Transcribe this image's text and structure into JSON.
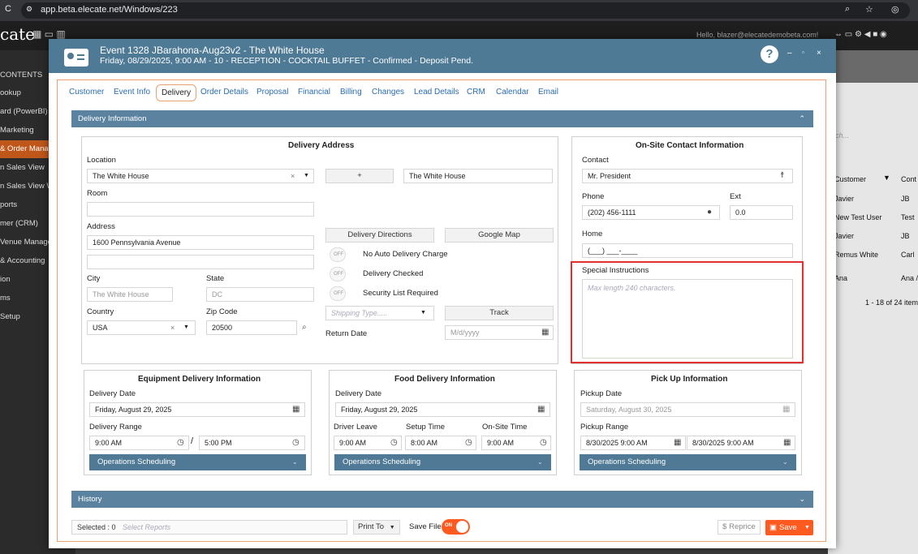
{
  "browser": {
    "url": "app.beta.elecate.net/Windows/223"
  },
  "bg_app": {
    "logo": "cate",
    "greeting": "Hello, blazer@elecatedemobeta.com!",
    "sidebar": [
      "CONTENTS",
      "ookup",
      "ard (PowerBI)",
      "Marketing",
      "& Order Manag",
      "n Sales View",
      "n Sales View W",
      "ports",
      "mer (CRM)",
      "Venue Manage",
      "& Accounting",
      "ion",
      "ms",
      "Setup"
    ],
    "search_placeholder": "rch...",
    "cols": [
      "Customer",
      "Cont"
    ],
    "rows": [
      [
        "Javier",
        "JB"
      ],
      [
        "New Test User",
        "Test"
      ],
      [
        "Javier",
        "JB"
      ],
      [
        "Remus White",
        "Carl"
      ],
      [
        "Ana",
        "Ana /"
      ]
    ],
    "paging": "1 - 18 of 24 item"
  },
  "modal": {
    "title": "Event 1328 JBarahona-Aug23v2 - The White House",
    "subtitle": "Friday, 08/29/2025, 9:00 AM - 10 - RECEPTION - COCKTAIL BUFFET - Confirmed - Deposit Pend.",
    "tabs": [
      "Customer",
      "Event Info",
      "Delivery",
      "Order Details",
      "Proposal",
      "Financial",
      "Billing",
      "Changes",
      "Lead Details",
      "CRM",
      "Calendar",
      "Email"
    ],
    "delivery_info_label": "Delivery Information",
    "history_label": "History"
  },
  "address": {
    "title": "Delivery Address",
    "location_label": "Location",
    "location": "The White House",
    "plus": "+",
    "location_name": "The White House",
    "room_label": "Room",
    "address_label": "Address",
    "address1": "1600 Pennsylvania Avenue",
    "city_label": "City",
    "city": "The White House",
    "state_label": "State",
    "state": "DC",
    "country_label": "Country",
    "country": "USA",
    "zip_label": "Zip Code",
    "zip": "20500",
    "directions_btn": "Delivery Directions",
    "map_btn": "Google Map",
    "toggle_off": "OFF",
    "no_auto": "No Auto Delivery Charge",
    "checked": "Delivery Checked",
    "security": "Security List Required",
    "shipping_placeholder": "Shipping Type.....",
    "track_btn": "Track",
    "return_label": "Return Date",
    "return_placeholder": "M/d/yyyy"
  },
  "contact": {
    "title": "On-Site Contact Information",
    "contact_label": "Contact",
    "contact": "Mr. President",
    "phone_label": "Phone",
    "phone": "(202) 456-1111",
    "ext_label": "Ext",
    "ext": "0.0",
    "home_label": "Home",
    "home": "(___) ___-____",
    "special_label": "Special Instructions",
    "special_placeholder": "Max length 240 characters."
  },
  "equipment": {
    "title": "Equipment Delivery Information",
    "date_label": "Delivery Date",
    "date": "Friday, August 29, 2025",
    "range_label": "Delivery Range",
    "from": "9:00 AM",
    "sep": "/",
    "to": "5:00 PM",
    "ops": "Operations Scheduling"
  },
  "food": {
    "title": "Food Delivery Information",
    "date_label": "Delivery Date",
    "date": "Friday, August 29, 2025",
    "leave_label": "Driver Leave",
    "setup_label": "Setup Time",
    "onsite_label": "On-Site Time",
    "leave": "9:00 AM",
    "setup": "8:00 AM",
    "onsite": "9:00 AM",
    "ops": "Operations Scheduling"
  },
  "pickup": {
    "title": "Pick Up Information",
    "date_label": "Pickup Date",
    "date": "Saturday, August 30, 2025",
    "range_label": "Pickup Range",
    "from": "8/30/2025 9:00 AM",
    "to": "8/30/2025 9:00 AM",
    "ops": "Operations Scheduling"
  },
  "footer": {
    "selected": "Selected : 0",
    "reports_placeholder": "Select Reports",
    "print": "Print To",
    "save_file": "Save File",
    "on": "ON",
    "reprice": "$ Reprice",
    "save": "Save"
  },
  "colors": {
    "header": "#4e7a96",
    "accent": "#ff5a1f",
    "highlight": "#e23030"
  }
}
